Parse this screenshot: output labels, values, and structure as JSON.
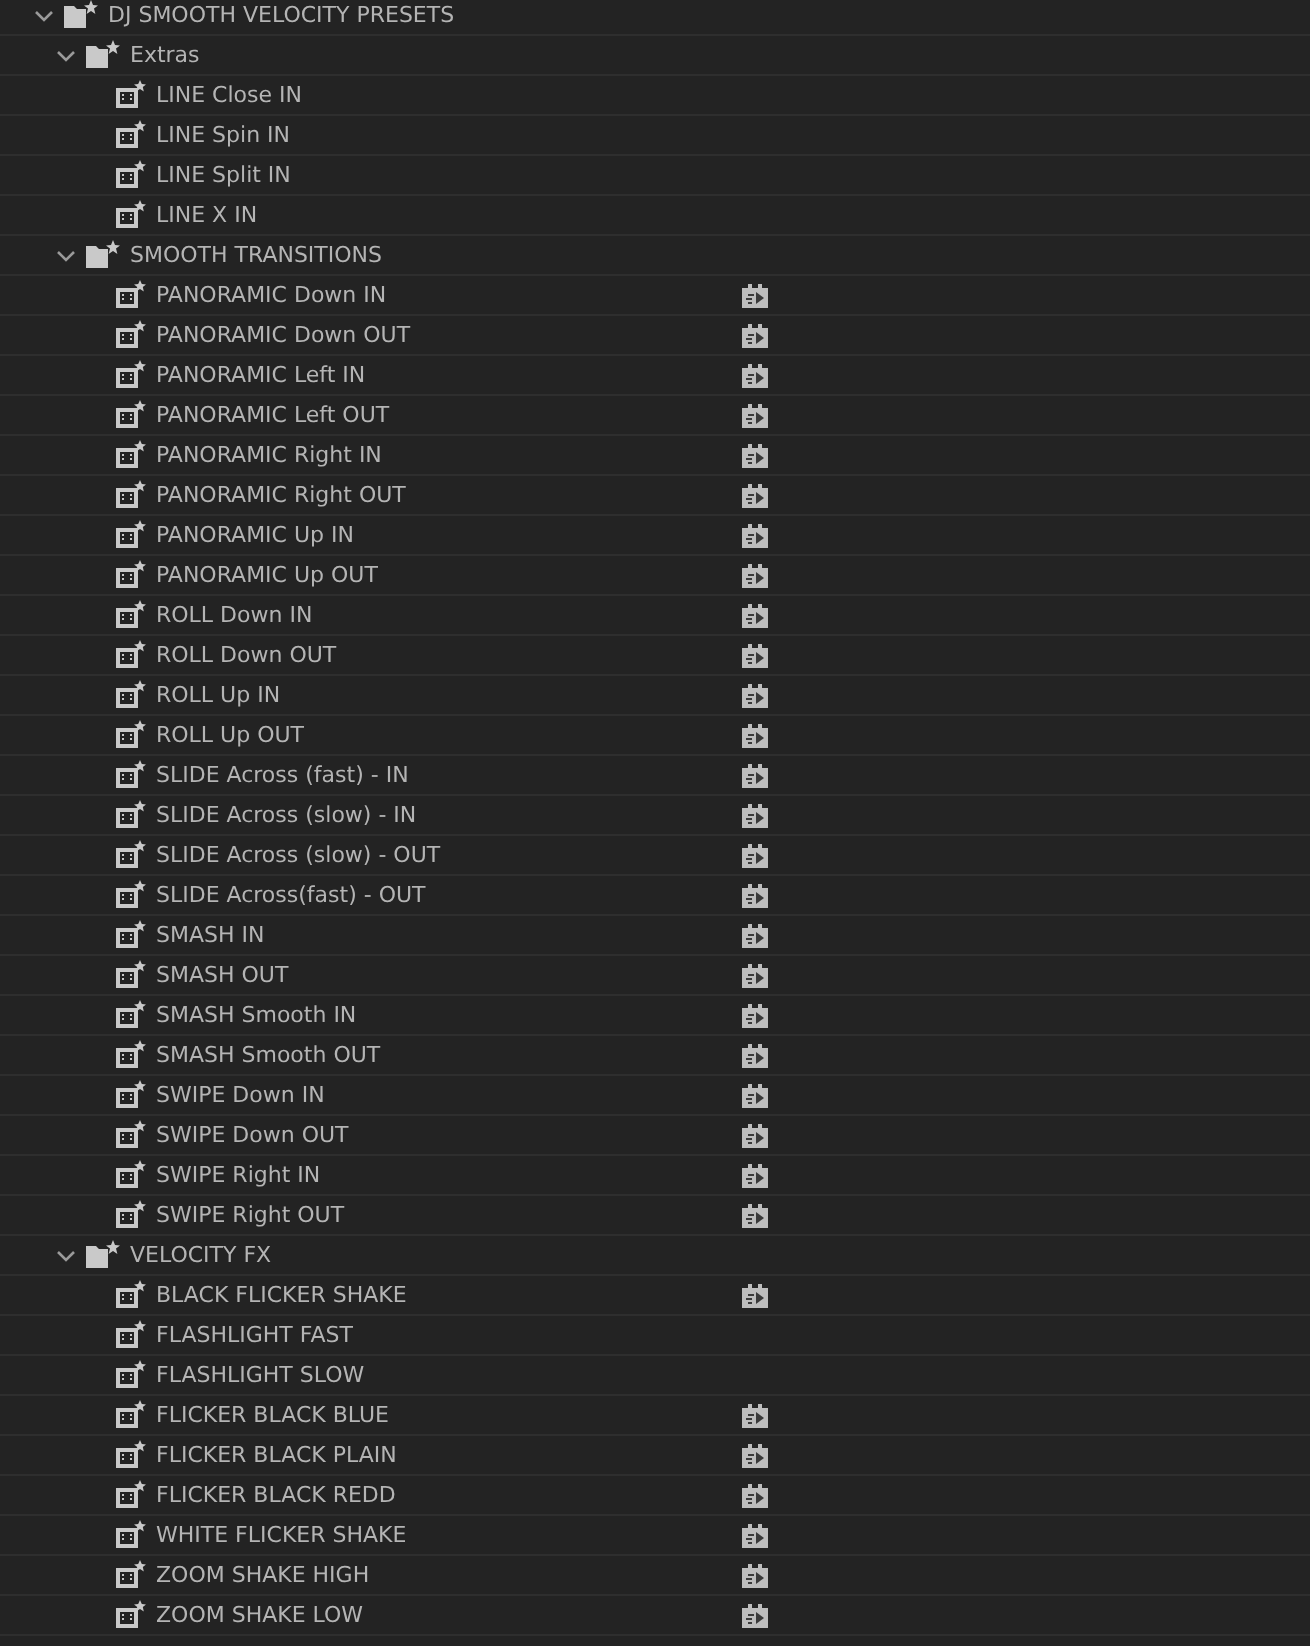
{
  "tree": [
    {
      "kind": "folder",
      "label": "DJ SMOOTH VELOCITY PRESETS",
      "expanded": true,
      "children": [
        {
          "kind": "folder",
          "label": "Extras",
          "expanded": true,
          "children": [
            {
              "kind": "preset",
              "label": "LINE Close IN",
              "accelerated": false
            },
            {
              "kind": "preset",
              "label": "LINE Spin IN",
              "accelerated": false
            },
            {
              "kind": "preset",
              "label": "LINE Split IN",
              "accelerated": false
            },
            {
              "kind": "preset",
              "label": "LINE X IN",
              "accelerated": false
            }
          ]
        },
        {
          "kind": "folder",
          "label": "SMOOTH TRANSITIONS",
          "expanded": true,
          "children": [
            {
              "kind": "preset",
              "label": "PANORAMIC Down IN",
              "accelerated": true
            },
            {
              "kind": "preset",
              "label": "PANORAMIC Down OUT",
              "accelerated": true
            },
            {
              "kind": "preset",
              "label": "PANORAMIC Left IN",
              "accelerated": true
            },
            {
              "kind": "preset",
              "label": "PANORAMIC Left OUT",
              "accelerated": true
            },
            {
              "kind": "preset",
              "label": "PANORAMIC Right IN",
              "accelerated": true
            },
            {
              "kind": "preset",
              "label": "PANORAMIC Right OUT",
              "accelerated": true
            },
            {
              "kind": "preset",
              "label": "PANORAMIC Up IN",
              "accelerated": true
            },
            {
              "kind": "preset",
              "label": "PANORAMIC Up OUT",
              "accelerated": true
            },
            {
              "kind": "preset",
              "label": "ROLL Down IN",
              "accelerated": true
            },
            {
              "kind": "preset",
              "label": "ROLL Down OUT",
              "accelerated": true
            },
            {
              "kind": "preset",
              "label": "ROLL Up IN",
              "accelerated": true
            },
            {
              "kind": "preset",
              "label": "ROLL Up OUT",
              "accelerated": true
            },
            {
              "kind": "preset",
              "label": "SLIDE Across (fast) - IN",
              "accelerated": true
            },
            {
              "kind": "preset",
              "label": "SLIDE Across (slow) - IN",
              "accelerated": true
            },
            {
              "kind": "preset",
              "label": "SLIDE Across (slow) - OUT",
              "accelerated": true
            },
            {
              "kind": "preset",
              "label": "SLIDE Across(fast) - OUT",
              "accelerated": true
            },
            {
              "kind": "preset",
              "label": "SMASH IN",
              "accelerated": true
            },
            {
              "kind": "preset",
              "label": "SMASH OUT",
              "accelerated": true
            },
            {
              "kind": "preset",
              "label": "SMASH Smooth IN",
              "accelerated": true
            },
            {
              "kind": "preset",
              "label": "SMASH Smooth OUT",
              "accelerated": true
            },
            {
              "kind": "preset",
              "label": "SWIPE Down IN",
              "accelerated": true
            },
            {
              "kind": "preset",
              "label": "SWIPE Down OUT",
              "accelerated": true
            },
            {
              "kind": "preset",
              "label": "SWIPE Right IN",
              "accelerated": true
            },
            {
              "kind": "preset",
              "label": "SWIPE Right OUT",
              "accelerated": true
            }
          ]
        },
        {
          "kind": "folder",
          "label": "VELOCITY FX",
          "expanded": true,
          "children": [
            {
              "kind": "preset",
              "label": "BLACK FLICKER SHAKE",
              "accelerated": true
            },
            {
              "kind": "preset",
              "label": "FLASHLIGHT FAST",
              "accelerated": false
            },
            {
              "kind": "preset",
              "label": "FLASHLIGHT SLOW",
              "accelerated": false
            },
            {
              "kind": "preset",
              "label": "FLICKER BLACK BLUE",
              "accelerated": true
            },
            {
              "kind": "preset",
              "label": "FLICKER BLACK PLAIN",
              "accelerated": true
            },
            {
              "kind": "preset",
              "label": "FLICKER BLACK REDD",
              "accelerated": true
            },
            {
              "kind": "preset",
              "label": "WHITE FLICKER SHAKE",
              "accelerated": true
            },
            {
              "kind": "preset",
              "label": "ZOOM SHAKE HIGH",
              "accelerated": true
            },
            {
              "kind": "preset",
              "label": "ZOOM SHAKE LOW",
              "accelerated": true
            }
          ]
        }
      ]
    }
  ]
}
